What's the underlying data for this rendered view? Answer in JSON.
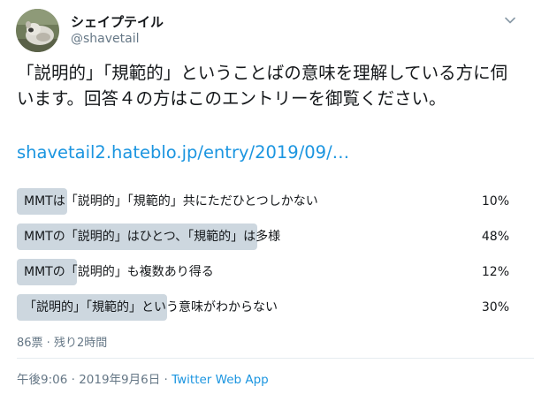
{
  "user": {
    "display_name": "シェイプテイル",
    "handle": "@shavetail",
    "avatar_icon": "dog-avatar"
  },
  "menu_icon": "chevron-down-icon",
  "tweet": {
    "text": "「説明的」「規範的」ということばの意味を理解している方に伺います。回答４の方はこのエントリーを御覧ください。",
    "link": "shavetail2.hateblo.jp/entry/2019/09/…"
  },
  "poll": {
    "options": [
      {
        "label": "MMTは「説明的」「規範的」共にただひとつしかない",
        "percent": "10%",
        "value": 10
      },
      {
        "label": "MMTの「説明的」はひとつ、「規範的」は多様",
        "percent": "48%",
        "value": 48
      },
      {
        "label": "MMTの「説明的」も複数あり得る",
        "percent": "12%",
        "value": 12
      },
      {
        "label": "「説明的」「規範的」という意味がわからない",
        "percent": "30%",
        "value": 30
      }
    ],
    "meta": "86票 · 残り2時間",
    "bar_color": "#cdd7df"
  },
  "footer": {
    "time": "午後9:06 · 2019年9月6日 · ",
    "source": "Twitter Web App"
  },
  "colors": {
    "link": "#1b95e0",
    "muted": "#657786",
    "text": "#14171a"
  }
}
